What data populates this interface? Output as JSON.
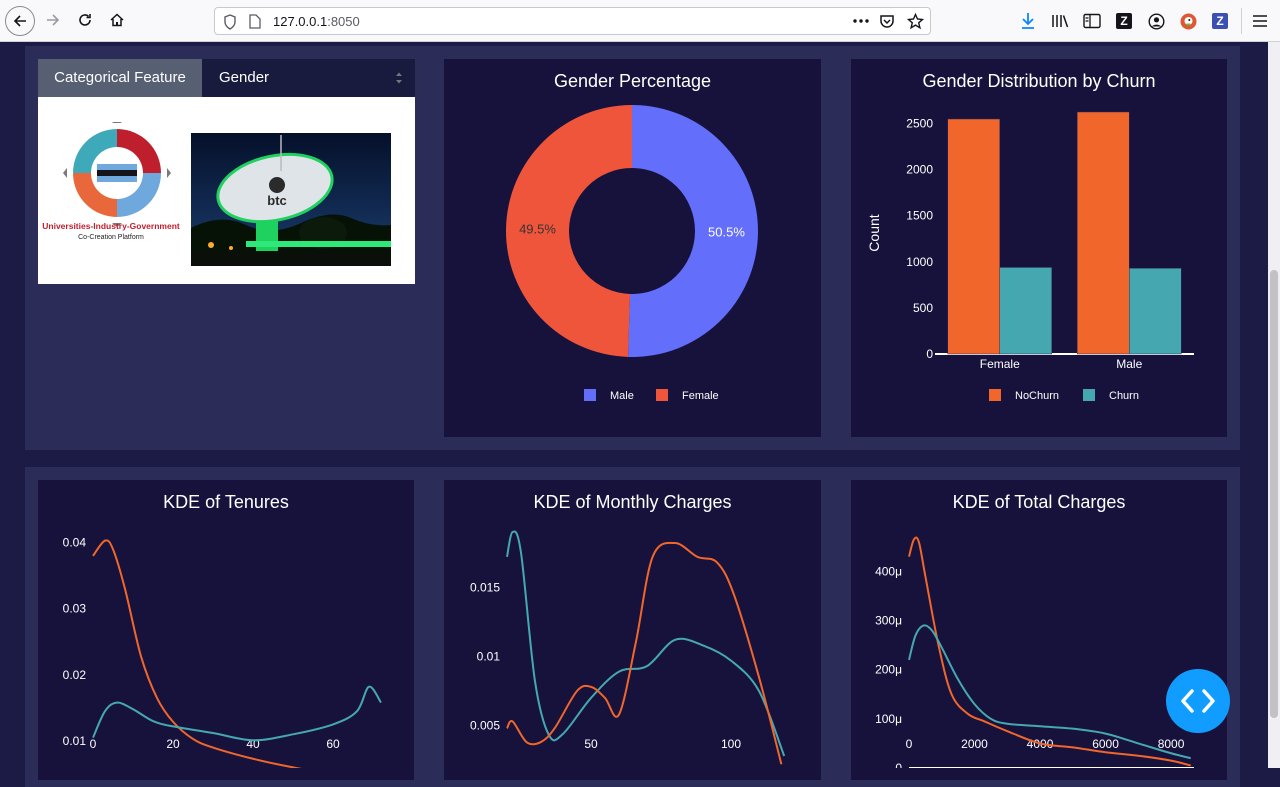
{
  "browser": {
    "url_host": "127.0.0.1",
    "url_port": ":8050",
    "icons": [
      "back-arrow-icon",
      "forward-arrow-icon",
      "reload-icon",
      "home-icon",
      "shield-icon",
      "page-icon",
      "more-dots-icon",
      "pocket-icon",
      "bookmark-star-icon",
      "download-icon",
      "library-icon",
      "sidebar-icon",
      "zotero-icon",
      "account-icon",
      "duckduckgo-icon",
      "zotero-z-icon",
      "menu-icon"
    ]
  },
  "filter": {
    "label": "Categorical Feature",
    "selected": "Gender"
  },
  "logo": {
    "line1": "Universities-Industry-Government",
    "line2": "Co-Creation Platform"
  },
  "photo": {
    "sign_text": "btc"
  },
  "colors": {
    "male": "#636efa",
    "female": "#ef553b",
    "nochurn": "#f0662b",
    "churn": "#45a8b0",
    "card_bg": "#17123c",
    "row_bg": "#2b2c57"
  },
  "charts": {
    "pie_title": "Gender Percentage",
    "bar_title": "Gender Distribution by Churn",
    "kde_tenure_title": "KDE of Tenures",
    "kde_monthly_title": "KDE of Monthly Charges",
    "kde_total_title": "KDE of Total Charges"
  },
  "chart_data": [
    {
      "type": "pie",
      "title": "Gender Percentage",
      "labels": [
        "Male",
        "Female"
      ],
      "values": [
        50.5,
        49.5
      ],
      "hole": 0.5,
      "legend": "bottom"
    },
    {
      "type": "bar",
      "title": "Gender Distribution by Churn",
      "categories": [
        "Female",
        "Male"
      ],
      "series": [
        {
          "name": "NoChurn",
          "values": [
            2549,
            2625
          ]
        },
        {
          "name": "Churn",
          "values": [
            939,
            930
          ]
        }
      ],
      "ylabel": "Count",
      "ylim": [
        0,
        2625
      ],
      "yticks": [
        0,
        500,
        1000,
        1500,
        2000,
        2500
      ],
      "legend": "bottom"
    },
    {
      "type": "line",
      "title": "KDE of Tenures",
      "xlim": [
        0,
        72
      ],
      "ylim": [
        0.0056,
        0.041
      ],
      "xticks": [
        "0",
        "20",
        "40",
        "60"
      ],
      "yticks": [
        "0.01",
        "0.02",
        "0.03",
        "0.04"
      ],
      "series": [
        {
          "color": "#f0662b",
          "x": [
            0,
            3,
            5,
            8,
            12,
            16,
            20,
            25,
            30,
            40,
            50,
            60,
            68,
            72
          ],
          "y": [
            0.038,
            0.0403,
            0.039,
            0.033,
            0.0228,
            0.0165,
            0.0129,
            0.0103,
            0.009,
            0.0073,
            0.006,
            0.005,
            0.0045,
            0.0032
          ]
        },
        {
          "color": "#45a8b0",
          "x": [
            0,
            3,
            6,
            10,
            15,
            20,
            30,
            40,
            50,
            60,
            66,
            69,
            72
          ],
          "y": [
            0.0105,
            0.0145,
            0.0158,
            0.0148,
            0.013,
            0.0122,
            0.0112,
            0.0101,
            0.011,
            0.0125,
            0.0145,
            0.0182,
            0.0158
          ]
        }
      ]
    },
    {
      "type": "line",
      "title": "KDE of Monthly Charges",
      "xlim": [
        20,
        120
      ],
      "ylim": [
        0.0028,
        0.019
      ],
      "xticks": [
        "50",
        "100"
      ],
      "yticks": [
        "0.005",
        "0.01",
        "0.015"
      ],
      "series": [
        {
          "color": "#45a8b0",
          "x": [
            20,
            22,
            25,
            30,
            35,
            40,
            50,
            60,
            70,
            80,
            90,
            100,
            110,
            119
          ],
          "y": [
            0.0172,
            0.019,
            0.0175,
            0.0082,
            0.0043,
            0.0044,
            0.007,
            0.0089,
            0.0093,
            0.0112,
            0.0108,
            0.0097,
            0.0075,
            0.0028
          ]
        },
        {
          "color": "#f0662b",
          "x": [
            20,
            22,
            27,
            32,
            37,
            45,
            50,
            55,
            60,
            66,
            72,
            80,
            88,
            95,
            101,
            110,
            118
          ],
          "y": [
            0.0048,
            0.0053,
            0.0038,
            0.0038,
            0.0048,
            0.0075,
            0.0078,
            0.007,
            0.0058,
            0.011,
            0.0172,
            0.0182,
            0.0172,
            0.0168,
            0.0145,
            0.0085,
            0.0022
          ]
        }
      ]
    },
    {
      "type": "line",
      "title": "KDE of Total Charges",
      "xlim": [
        0,
        8700
      ],
      "ylim": [
        0,
        470
      ],
      "xticks": [
        "0",
        "2000",
        "4000",
        "6000",
        "8000"
      ],
      "yticks": [
        "0",
        "100μ",
        "200μ",
        "300μ",
        "400μ"
      ],
      "series": [
        {
          "color": "#f0662b",
          "x": [
            0,
            150,
            300,
            500,
            900,
            1300,
            1800,
            2300,
            3000,
            4000,
            5000,
            6000,
            7000,
            8000,
            8600
          ],
          "y": [
            430,
            465,
            460,
            390,
            250,
            150,
            110,
            95,
            75,
            50,
            42,
            32,
            25,
            15,
            5
          ]
        },
        {
          "color": "#45a8b0",
          "x": [
            0,
            200,
            450,
            700,
            1000,
            1500,
            2000,
            2500,
            3000,
            4000,
            5000,
            6000,
            7000,
            8000,
            8600
          ],
          "y": [
            220,
            270,
            290,
            280,
            245,
            180,
            130,
            100,
            90,
            85,
            80,
            70,
            50,
            30,
            20
          ]
        }
      ]
    }
  ]
}
